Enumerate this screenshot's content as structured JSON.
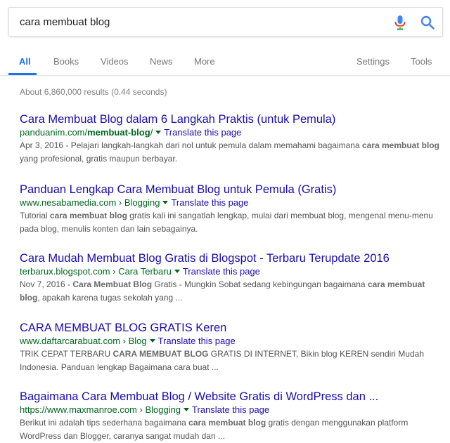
{
  "search": {
    "query": "cara membuat blog",
    "mic_icon": "microphone-icon",
    "search_icon": "magnifier-icon"
  },
  "tabs": {
    "items": [
      {
        "label": "All"
      },
      {
        "label": "Books"
      },
      {
        "label": "Videos"
      },
      {
        "label": "News"
      },
      {
        "label": "More"
      },
      {
        "label": "Settings"
      },
      {
        "label": "Tools"
      }
    ],
    "active": "All",
    "accent_color": "#1a73e8"
  },
  "stats": "About 6,860,000 results (0.44 seconds)",
  "results": [
    {
      "title": "Cara Membuat Blog dalam 6 Langkah Praktis (untuk Pemula)",
      "url_pre": "panduanim.com/",
      "url_bold": "membuat-blog",
      "url_post": "/",
      "translate": "Translate this page",
      "snippet": [
        {
          "t": "Apr 3, 2016 - Pelajari langkah-langkah dari nol untuk pemula dalam memahami bagaimana "
        },
        {
          "b": "cara membuat blog"
        },
        {
          "t": " yang profesional, gratis maupun berbayar."
        }
      ]
    },
    {
      "title": "Panduan Lengkap Cara Membuat Blog untuk Pemula (Gratis)",
      "url_pre": "www.nesabamedia.com › Blogging",
      "url_bold": "",
      "url_post": "",
      "translate": "Translate this page",
      "snippet": [
        {
          "t": "Tutorial "
        },
        {
          "b": "cara membuat blog"
        },
        {
          "t": " gratis kali ini sangatlah lengkap, mulai dari membuat blog, mengenal menu-menu pada blog, menulis konten dan lain sebagainya."
        }
      ]
    },
    {
      "title": "Cara Mudah Membuat Blog Gratis di Blogspot - Terbaru Terupdate 2016",
      "url_pre": "terbarux.blogspot.com › Cara Terbaru",
      "url_bold": "",
      "url_post": "",
      "translate": "Translate this page",
      "snippet": [
        {
          "t": "Nov 7, 2016 - "
        },
        {
          "b": "Cara Membuat Blog"
        },
        {
          "t": " Gratis - Mungkin Sobat sedang kebingungan bagaimana "
        },
        {
          "b": "cara membuat blog"
        },
        {
          "t": ", apakah karena tugas sekolah yang ..."
        }
      ]
    },
    {
      "title": "CARA MEMBUAT BLOG GRATIS Keren",
      "url_pre": "www.daftarcarabuat.com › Blog",
      "url_bold": "",
      "url_post": "",
      "translate": "Translate this page",
      "snippet": [
        {
          "t": "TRIK CEPAT TERBARU "
        },
        {
          "b": "CARA MEMBUAT BLOG"
        },
        {
          "t": " GRATIS DI INTERNET, Bikin blog KEREN sendiri Mudah Indonesia. Panduan lengkap Bagaimana cara buat ..."
        }
      ]
    },
    {
      "title": "Bagaimana Cara Membuat Blog / Website Gratis di WordPress dan ...",
      "url_pre": "https://www.maxmanroe.com › Blogging",
      "url_bold": "",
      "url_post": "",
      "translate": "Translate this page",
      "snippet": [
        {
          "t": "Berikut ini adalah tips sederhana bagaimana "
        },
        {
          "b": "cara membuat blog"
        },
        {
          "t": " gratis dengan menggunakan platform WordPress dan Blogger, caranya sangat mudah dan ..."
        }
      ]
    }
  ],
  "colors": {
    "title_link": "#1a0dab",
    "url_green": "#006621",
    "snippet": "#545454"
  }
}
